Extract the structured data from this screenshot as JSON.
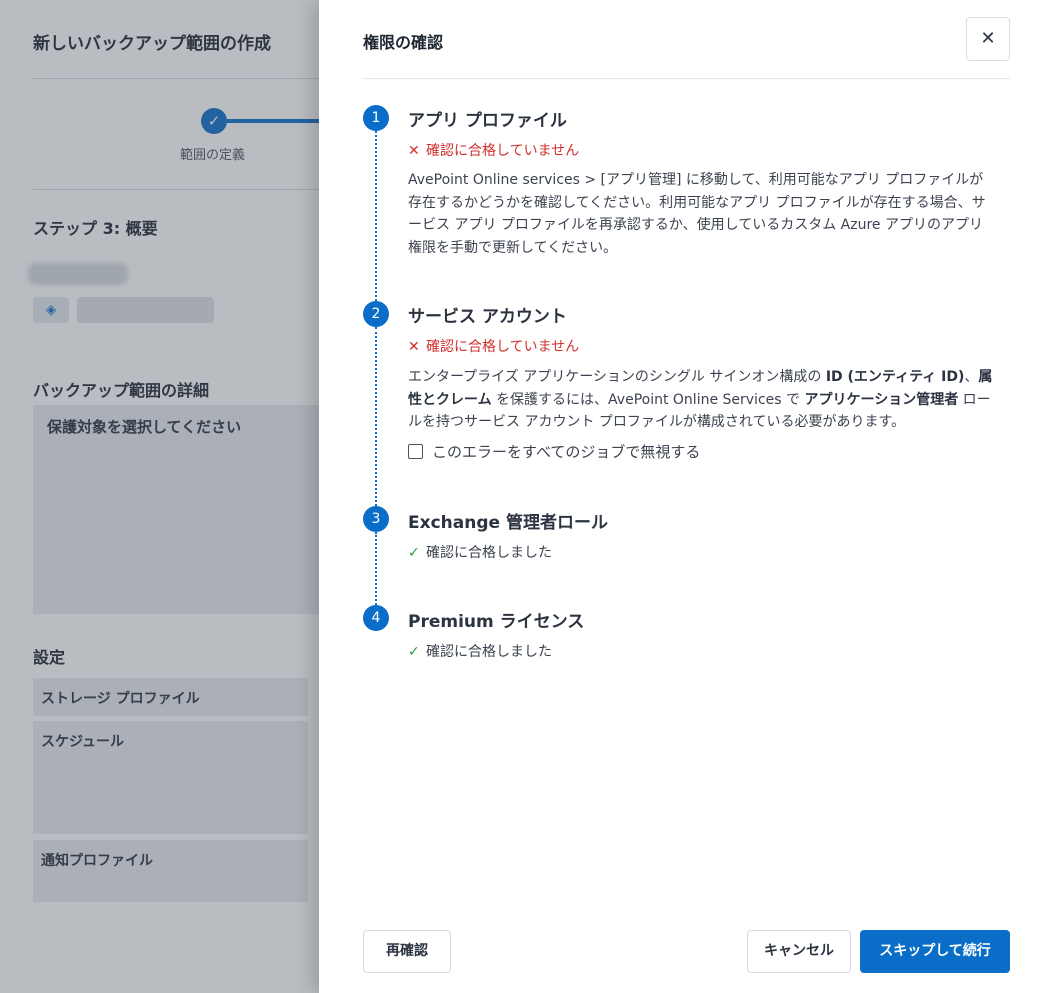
{
  "background": {
    "page_title": "新しいバックアップ範囲の作成",
    "stepper": {
      "step_label": "範囲の定義"
    },
    "step_heading": "ステップ 3: 概要",
    "details_heading": "バックアップ範囲の詳細",
    "details_placeholder": "保護対象を選択してください",
    "settings_heading": "設定",
    "settings_rows": [
      "ストレージ プロファイル",
      "スケジュール",
      "通知プロファイル"
    ]
  },
  "drawer": {
    "title": "権限の確認",
    "close_label": "✕",
    "sections": [
      {
        "number": "1",
        "title": "アプリ プロファイル",
        "status": "fail",
        "status_text": "確認に合格していません",
        "description": "AvePoint Online services > [アプリ管理] に移動して、利用可能なアプリ プロファイルが存在するかどうかを確認してください。利用可能なアプリ プロファイルが存在する場合、サービス アプリ プロファイルを再承認するか、使用しているカスタム Azure アプリのアプリ権限を手動で更新してください。"
      },
      {
        "number": "2",
        "title": "サービス アカウント",
        "status": "fail",
        "status_text": "確認に合格していません",
        "description_parts": [
          "エンタープライズ アプリケーションのシングル サインオン構成の ",
          "ID (エンティティ ID)",
          "、",
          "属性とクレーム",
          " を保護するには、AvePoint Online Services で ",
          "アプリケーション管理者",
          " ロールを持つサービス アカウント プロファイルが構成されている必要があります。"
        ],
        "ignore_checkbox_label": "このエラーをすべてのジョブで無視する",
        "ignore_checked": false
      },
      {
        "number": "3",
        "title": "Exchange 管理者ロール",
        "status": "pass",
        "status_text": "確認に合格しました"
      },
      {
        "number": "4",
        "title": "Premium ライセンス",
        "status": "pass",
        "status_text": "確認に合格しました"
      }
    ],
    "icons": {
      "fail": "✕",
      "pass": "✓"
    },
    "colors": {
      "accent": "#0a6ec9",
      "fail": "#d0312d",
      "pass": "#23a045"
    },
    "footer": {
      "recheck_label": "再確認",
      "cancel_label": "キャンセル",
      "skip_continue_label": "スキップして続行"
    }
  }
}
